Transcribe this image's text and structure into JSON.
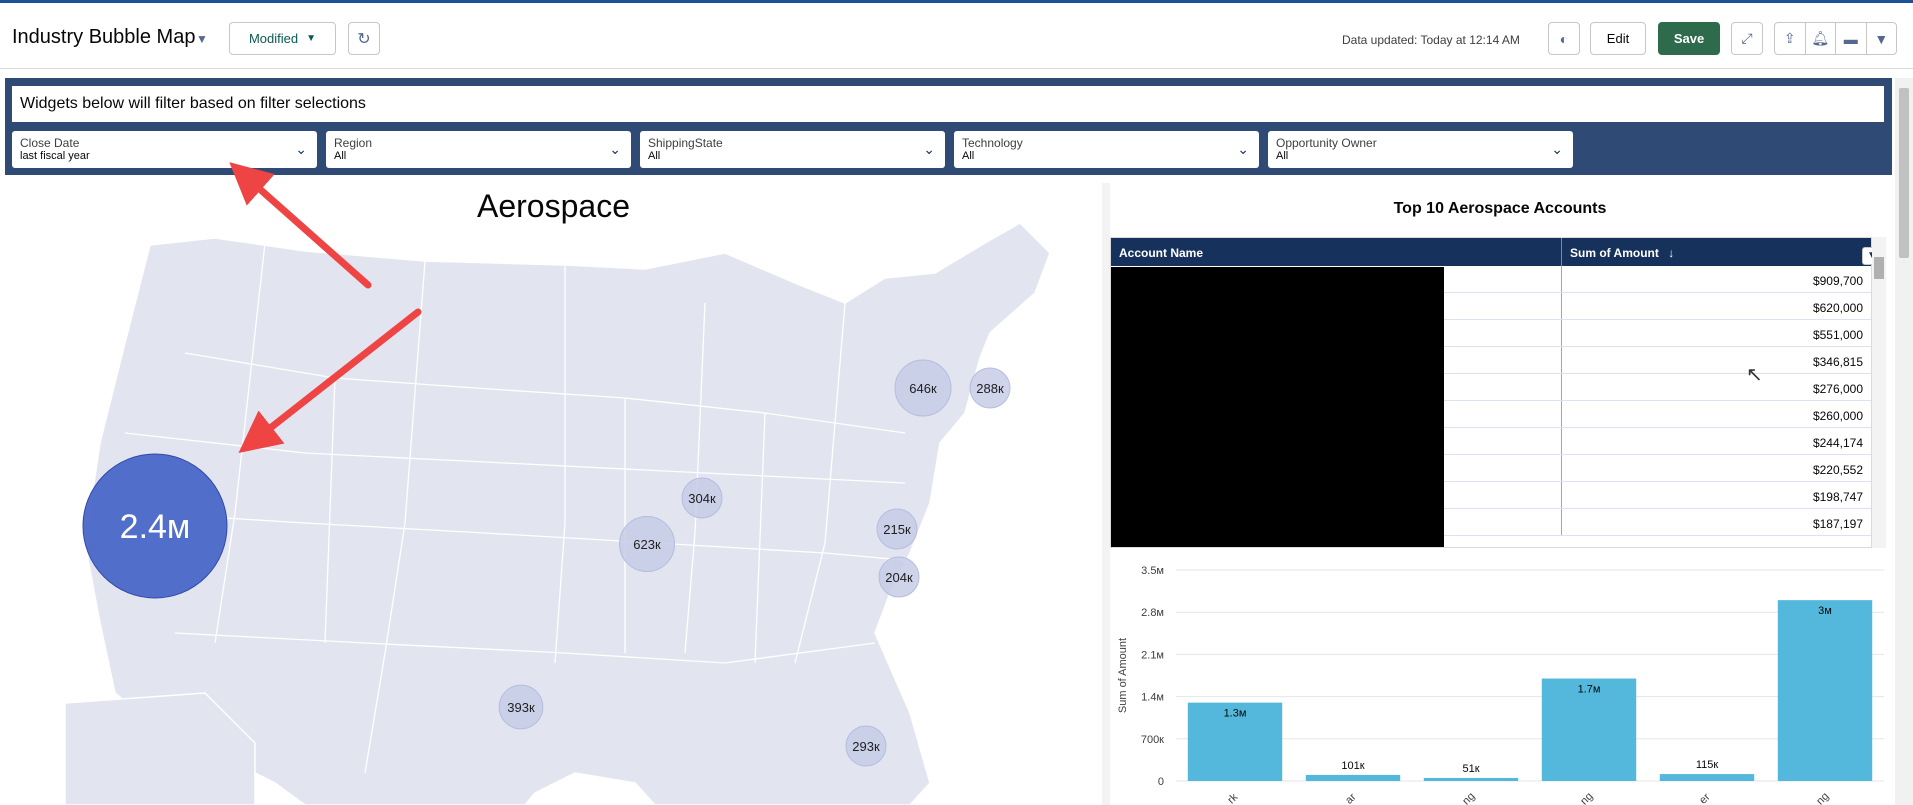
{
  "header": {
    "title": "Industry Bubble Map",
    "modified_label": "Modified",
    "updated_text": "Data updated: Today at 12:14 AM",
    "edit_label": "Edit",
    "save_label": "Save"
  },
  "filters": {
    "note": "Widgets below will filter based on filter selections",
    "items": [
      {
        "label": "Close Date",
        "value": "last fiscal year"
      },
      {
        "label": "Region",
        "value": "All"
      },
      {
        "label": "ShippingState",
        "value": "All"
      },
      {
        "label": "Technology",
        "value": "All"
      },
      {
        "label": "Opportunity Owner",
        "value": "All"
      }
    ]
  },
  "map": {
    "title": "Aerospace",
    "bubbles": [
      {
        "label": "2.4м",
        "value": 2400000
      },
      {
        "label": "646к",
        "value": 646000
      },
      {
        "label": "288к",
        "value": 288000
      },
      {
        "label": "623к",
        "value": 623000
      },
      {
        "label": "304к",
        "value": 304000
      },
      {
        "label": "215к",
        "value": 215000
      },
      {
        "label": "204к",
        "value": 204000
      },
      {
        "label": "393к",
        "value": 393000
      },
      {
        "label": "293к",
        "value": 293000
      }
    ],
    "bubble_color": "#4a67c8",
    "small_bubble_color": "#c7cce8"
  },
  "table": {
    "title": "Top 10 Aerospace Accounts",
    "col1": "Account Name",
    "col2": "Sum of Amount",
    "sort_icon": "↓",
    "amounts": [
      "$909,700",
      "$620,000",
      "$551,000",
      "$346,815",
      "$276,000",
      "$260,000",
      "$244,174",
      "$220,552",
      "$198,747",
      "$187,197"
    ]
  },
  "chart_data": {
    "type": "bar",
    "ylabel": "Sum of Amount",
    "yticks": [
      "3.5м",
      "2.8м",
      "2.1м",
      "1.4м",
      "700к",
      "0"
    ],
    "ylim": [
      0,
      3500000
    ],
    "categories": [
      "rk",
      "ar",
      "ng",
      "ng",
      "er",
      "ng"
    ],
    "values": [
      1300000,
      101000,
      51000,
      1700000,
      115000,
      3000000
    ],
    "data_labels": [
      "1.3м",
      "101к",
      "51к",
      "1.7м",
      "115к",
      "3м"
    ],
    "bar_color": "#54b7dc"
  }
}
